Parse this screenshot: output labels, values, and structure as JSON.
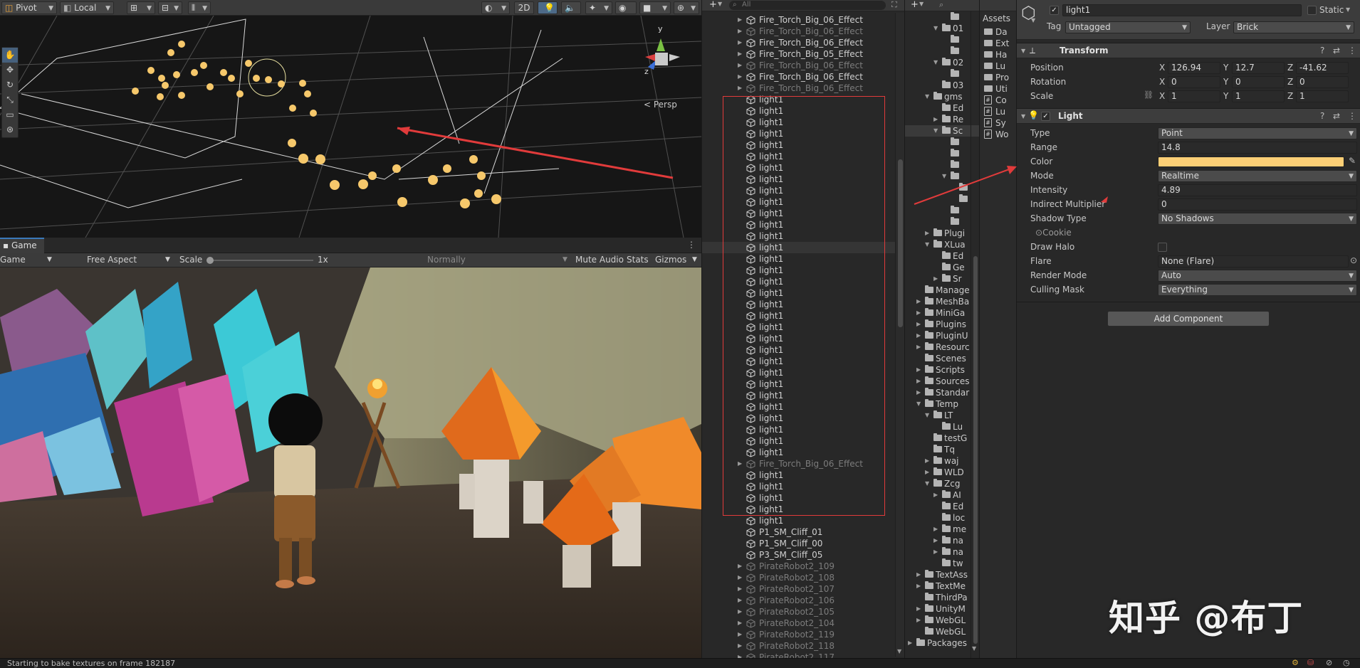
{
  "colors": {
    "light_color": "#fccf76",
    "annotation_red": "#e13b3b",
    "accent_blue": "#3a79bb"
  },
  "scene_toolbar": {
    "pivot": "Pivot",
    "local": "Local",
    "mode_2d": "2D",
    "persp": "< Persp"
  },
  "game": {
    "tab": "Game",
    "display": "Game",
    "aspect": "Free Aspect",
    "scale_label": "Scale",
    "scale_value": "1x",
    "quality": "Normally",
    "mute": "Mute Audio",
    "stats": "Stats",
    "gizmos": "Gizmos"
  },
  "status": {
    "message": "Starting to bake textures on frame 182187"
  },
  "hierarchy": {
    "search_placeholder": "All",
    "rows": [
      {
        "label": "Fire_Torch_Big_06_Effect",
        "dim": false,
        "arrow": true
      },
      {
        "label": "Fire_Torch_Big_06_Effect",
        "dim": true,
        "arrow": true
      },
      {
        "label": "Fire_Torch_Big_06_Effect",
        "dim": false,
        "arrow": true
      },
      {
        "label": "Fire_Torch_Big_05_Effect",
        "dim": false,
        "arrow": true
      },
      {
        "label": "Fire_Torch_Big_06_Effect",
        "dim": true,
        "arrow": true
      },
      {
        "label": "Fire_Torch_Big_06_Effect",
        "dim": false,
        "arrow": true
      },
      {
        "label": "Fire_Torch_Big_06_Effect",
        "dim": true,
        "arrow": true
      },
      {
        "label": "light1",
        "dim": false,
        "arrow": false
      },
      {
        "label": "light1",
        "dim": false,
        "arrow": false
      },
      {
        "label": "light1",
        "dim": false,
        "arrow": false
      },
      {
        "label": "light1",
        "dim": false,
        "arrow": false
      },
      {
        "label": "light1",
        "dim": false,
        "arrow": false
      },
      {
        "label": "light1",
        "dim": false,
        "arrow": false
      },
      {
        "label": "light1",
        "dim": false,
        "arrow": false
      },
      {
        "label": "light1",
        "dim": false,
        "arrow": false
      },
      {
        "label": "light1",
        "dim": false,
        "arrow": false
      },
      {
        "label": "light1",
        "dim": false,
        "arrow": false
      },
      {
        "label": "light1",
        "dim": false,
        "arrow": false
      },
      {
        "label": "light1",
        "dim": false,
        "arrow": false
      },
      {
        "label": "light1",
        "dim": false,
        "arrow": false
      },
      {
        "label": "light1",
        "dim": false,
        "arrow": false,
        "selected": true
      },
      {
        "label": "light1",
        "dim": false,
        "arrow": false
      },
      {
        "label": "light1",
        "dim": false,
        "arrow": false
      },
      {
        "label": "light1",
        "dim": false,
        "arrow": false
      },
      {
        "label": "light1",
        "dim": false,
        "arrow": false
      },
      {
        "label": "light1",
        "dim": false,
        "arrow": false
      },
      {
        "label": "light1",
        "dim": false,
        "arrow": false
      },
      {
        "label": "light1",
        "dim": false,
        "arrow": false
      },
      {
        "label": "light1",
        "dim": false,
        "arrow": false
      },
      {
        "label": "light1",
        "dim": false,
        "arrow": false
      },
      {
        "label": "light1",
        "dim": false,
        "arrow": false
      },
      {
        "label": "light1",
        "dim": false,
        "arrow": false
      },
      {
        "label": "light1",
        "dim": false,
        "arrow": false
      },
      {
        "label": "light1",
        "dim": false,
        "arrow": false
      },
      {
        "label": "light1",
        "dim": false,
        "arrow": false
      },
      {
        "label": "light1",
        "dim": false,
        "arrow": false
      },
      {
        "label": "light1",
        "dim": false,
        "arrow": false
      },
      {
        "label": "light1",
        "dim": false,
        "arrow": false
      },
      {
        "label": "light1",
        "dim": false,
        "arrow": false
      },
      {
        "label": "Fire_Torch_Big_06_Effect",
        "dim": true,
        "arrow": true
      },
      {
        "label": "light1",
        "dim": false,
        "arrow": false
      },
      {
        "label": "light1",
        "dim": false,
        "arrow": false
      },
      {
        "label": "light1",
        "dim": false,
        "arrow": false
      },
      {
        "label": "light1",
        "dim": false,
        "arrow": false
      },
      {
        "label": "light1",
        "dim": false,
        "arrow": false
      },
      {
        "label": "P1_SM_Cliff_01",
        "dim": false,
        "arrow": false
      },
      {
        "label": "P1_SM_Cliff_00",
        "dim": false,
        "arrow": false
      },
      {
        "label": "P3_SM_Cliff_05",
        "dim": false,
        "arrow": false
      },
      {
        "label": "PirateRobot2_109",
        "dim": true,
        "arrow": true
      },
      {
        "label": "PirateRobot2_108",
        "dim": true,
        "arrow": true
      },
      {
        "label": "PirateRobot2_107",
        "dim": true,
        "arrow": true
      },
      {
        "label": "PirateRobot2_106",
        "dim": true,
        "arrow": true
      },
      {
        "label": "PirateRobot2_105",
        "dim": true,
        "arrow": true
      },
      {
        "label": "PirateRobot2_104",
        "dim": true,
        "arrow": true
      },
      {
        "label": "PirateRobot2_119",
        "dim": true,
        "arrow": true
      },
      {
        "label": "PirateRobot2_118",
        "dim": true,
        "arrow": true
      },
      {
        "label": "PirateRobot2_117",
        "dim": true,
        "arrow": true
      }
    ]
  },
  "project": {
    "rows": [
      {
        "label": "",
        "depth": 3,
        "arrow": "",
        "folder": true
      },
      {
        "label": "01",
        "depth": 2,
        "arrow": "▼",
        "folder": true
      },
      {
        "label": "",
        "depth": 3,
        "arrow": "",
        "folder": true
      },
      {
        "label": "",
        "depth": 3,
        "arrow": "",
        "folder": true
      },
      {
        "label": "02",
        "depth": 2,
        "arrow": "▼",
        "folder": true
      },
      {
        "label": "",
        "depth": 3,
        "arrow": "",
        "folder": true
      },
      {
        "label": "03",
        "depth": 2,
        "arrow": "",
        "folder": true
      },
      {
        "label": "gms",
        "depth": 1,
        "arrow": "▼",
        "folder": true
      },
      {
        "label": "Ed",
        "depth": 2,
        "arrow": "",
        "folder": true
      },
      {
        "label": "Re",
        "depth": 2,
        "arrow": "▶",
        "folder": true
      },
      {
        "label": "Sc",
        "depth": 2,
        "arrow": "▼",
        "folder": true,
        "selected": true
      },
      {
        "label": "",
        "depth": 3,
        "arrow": "",
        "folder": true
      },
      {
        "label": "",
        "depth": 3,
        "arrow": "",
        "folder": true
      },
      {
        "label": "",
        "depth": 3,
        "arrow": "",
        "folder": true
      },
      {
        "label": "",
        "depth": 3,
        "arrow": "▼",
        "folder": true
      },
      {
        "label": "",
        "depth": 4,
        "arrow": "",
        "folder": true
      },
      {
        "label": "",
        "depth": 4,
        "arrow": "",
        "folder": true
      },
      {
        "label": "",
        "depth": 3,
        "arrow": "",
        "folder": true
      },
      {
        "label": "",
        "depth": 3,
        "arrow": "",
        "folder": true
      },
      {
        "label": "Plugi",
        "depth": 1,
        "arrow": "▶",
        "folder": true
      },
      {
        "label": "XLua",
        "depth": 1,
        "arrow": "▼",
        "folder": true
      },
      {
        "label": "Ed",
        "depth": 2,
        "arrow": "",
        "folder": true
      },
      {
        "label": "Ge",
        "depth": 2,
        "arrow": "",
        "folder": true
      },
      {
        "label": "Sr",
        "depth": 2,
        "arrow": "▶",
        "folder": true
      },
      {
        "label": "Manage",
        "depth": 0,
        "arrow": "",
        "folder": true
      },
      {
        "label": "MeshBa",
        "depth": 0,
        "arrow": "▶",
        "folder": true
      },
      {
        "label": "MiniGa",
        "depth": 0,
        "arrow": "▶",
        "folder": true
      },
      {
        "label": "Plugins",
        "depth": 0,
        "arrow": "▶",
        "folder": true
      },
      {
        "label": "PluginU",
        "depth": 0,
        "arrow": "▶",
        "folder": true
      },
      {
        "label": "Resourc",
        "depth": 0,
        "arrow": "▶",
        "folder": true
      },
      {
        "label": "Scenes",
        "depth": 0,
        "arrow": "",
        "folder": true
      },
      {
        "label": "Scripts",
        "depth": 0,
        "arrow": "▶",
        "folder": true
      },
      {
        "label": "Sources",
        "depth": 0,
        "arrow": "▶",
        "folder": true
      },
      {
        "label": "Standar",
        "depth": 0,
        "arrow": "▶",
        "folder": true
      },
      {
        "label": "Temp",
        "depth": 0,
        "arrow": "▼",
        "folder": true
      },
      {
        "label": "LT",
        "depth": 1,
        "arrow": "▼",
        "folder": true
      },
      {
        "label": "Lu",
        "depth": 2,
        "arrow": "",
        "folder": true
      },
      {
        "label": "testG",
        "depth": 1,
        "arrow": "",
        "folder": true
      },
      {
        "label": "Tq",
        "depth": 1,
        "arrow": "",
        "folder": true
      },
      {
        "label": "waj",
        "depth": 1,
        "arrow": "▶",
        "folder": true
      },
      {
        "label": "WLD",
        "depth": 1,
        "arrow": "▶",
        "folder": true
      },
      {
        "label": "Zcg",
        "depth": 1,
        "arrow": "▼",
        "folder": true
      },
      {
        "label": "AI",
        "depth": 2,
        "arrow": "▶",
        "folder": true
      },
      {
        "label": "Ed",
        "depth": 2,
        "arrow": "",
        "folder": true
      },
      {
        "label": "loc",
        "depth": 2,
        "arrow": "",
        "folder": true
      },
      {
        "label": "me",
        "depth": 2,
        "arrow": "▶",
        "folder": true
      },
      {
        "label": "na",
        "depth": 2,
        "arrow": "▶",
        "folder": true
      },
      {
        "label": "na",
        "depth": 2,
        "arrow": "▶",
        "folder": true
      },
      {
        "label": "tw",
        "depth": 2,
        "arrow": "",
        "folder": true
      },
      {
        "label": "TextAss",
        "depth": 0,
        "arrow": "▶",
        "folder": true
      },
      {
        "label": "TextMe",
        "depth": 0,
        "arrow": "▶",
        "folder": true
      },
      {
        "label": "ThirdPa",
        "depth": 0,
        "arrow": "",
        "folder": true
      },
      {
        "label": "UnityM",
        "depth": 0,
        "arrow": "▶",
        "folder": true
      },
      {
        "label": "WebGL",
        "depth": 0,
        "arrow": "▶",
        "folder": true
      },
      {
        "label": "WebGL",
        "depth": 0,
        "arrow": "",
        "folder": true
      },
      {
        "label": "Packages",
        "depth": -1,
        "arrow": "▶",
        "folder": true
      }
    ]
  },
  "assets": {
    "title": "Assets",
    "items": [
      {
        "label": "Da",
        "kind": "folder"
      },
      {
        "label": "Ext",
        "kind": "folder"
      },
      {
        "label": "Ha",
        "kind": "folder"
      },
      {
        "label": "Lu",
        "kind": "folder"
      },
      {
        "label": "Pro",
        "kind": "folder"
      },
      {
        "label": "Uti",
        "kind": "folder"
      },
      {
        "label": "Co",
        "kind": "script"
      },
      {
        "label": "Lu",
        "kind": "script"
      },
      {
        "label": "Sy",
        "kind": "script"
      },
      {
        "label": "Wo",
        "kind": "script"
      }
    ]
  },
  "inspector": {
    "object_name": "light1",
    "static_label": "Static",
    "tag_label": "Tag",
    "tag_value": "Untagged",
    "layer_label": "Layer",
    "layer_value": "Brick",
    "transform": {
      "title": "Transform",
      "position_label": "Position",
      "rotation_label": "Rotation",
      "scale_label": "Scale",
      "position": {
        "x": "126.94",
        "y": "12.7",
        "z": "-41.62"
      },
      "rotation": {
        "x": "0",
        "y": "0",
        "z": "0"
      },
      "scale": {
        "x": "1",
        "y": "1",
        "z": "1"
      },
      "axis_x": "X",
      "axis_y": "Y",
      "axis_z": "Z"
    },
    "light": {
      "title": "Light",
      "type_label": "Type",
      "type_value": "Point",
      "range_label": "Range",
      "range_value": "14.8",
      "color_label": "Color",
      "mode_label": "Mode",
      "mode_value": "Realtime",
      "intensity_label": "Intensity",
      "intensity_value": "4.89",
      "indirect_label": "Indirect Multiplier",
      "indirect_value": "0",
      "shadow_label": "Shadow Type",
      "shadow_value": "No Shadows",
      "cookie_label": "Cookie",
      "halo_label": "Draw Halo",
      "flare_label": "Flare",
      "flare_value": "None (Flare)",
      "render_label": "Render Mode",
      "render_value": "Auto",
      "culling_label": "Culling Mask",
      "culling_value": "Everything"
    },
    "add_component": "Add Component"
  },
  "watermark": "知乎 @布丁"
}
